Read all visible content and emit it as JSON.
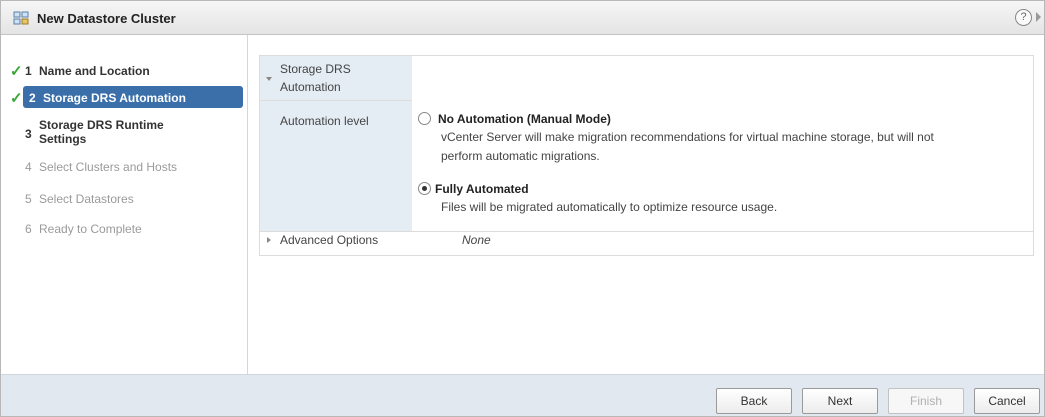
{
  "window": {
    "title": "New Datastore Cluster",
    "help_glyph": "?"
  },
  "steps": [
    {
      "num": "1",
      "label": "Name and Location",
      "state": "done"
    },
    {
      "num": "2",
      "label": "Storage DRS Automation",
      "state": "active"
    },
    {
      "num": "3",
      "label_line1": "Storage DRS Runtime",
      "label_line2": "Settings",
      "state": "pending"
    },
    {
      "num": "4",
      "label": "Select Clusters and Hosts",
      "state": "disabled"
    },
    {
      "num": "5",
      "label": "Select Datastores",
      "state": "disabled"
    },
    {
      "num": "6",
      "label": "Ready to Complete",
      "state": "disabled"
    }
  ],
  "section": {
    "title_line1": "Storage DRS",
    "title_line2": "Automation",
    "automation_label": "Automation level",
    "options": [
      {
        "title": "No Automation (Manual Mode)",
        "desc_line1": "vCenter Server will make migration recommendations for virtual machine storage, but will not",
        "desc_line2": "perform automatic migrations.",
        "selected": false
      },
      {
        "title": "Fully Automated",
        "desc_line1": "Files will be migrated automatically to optimize resource usage.",
        "selected": true
      }
    ],
    "advanced_label": "Advanced Options",
    "advanced_value": "None"
  },
  "buttons": {
    "back": "Back",
    "next": "Next",
    "finish": "Finish",
    "cancel": "Cancel"
  },
  "colors": {
    "accent": "#3a6fa9",
    "check": "#3aa636",
    "label_bg": "#e5edf4",
    "footer_bg": "#e1e8f0"
  }
}
